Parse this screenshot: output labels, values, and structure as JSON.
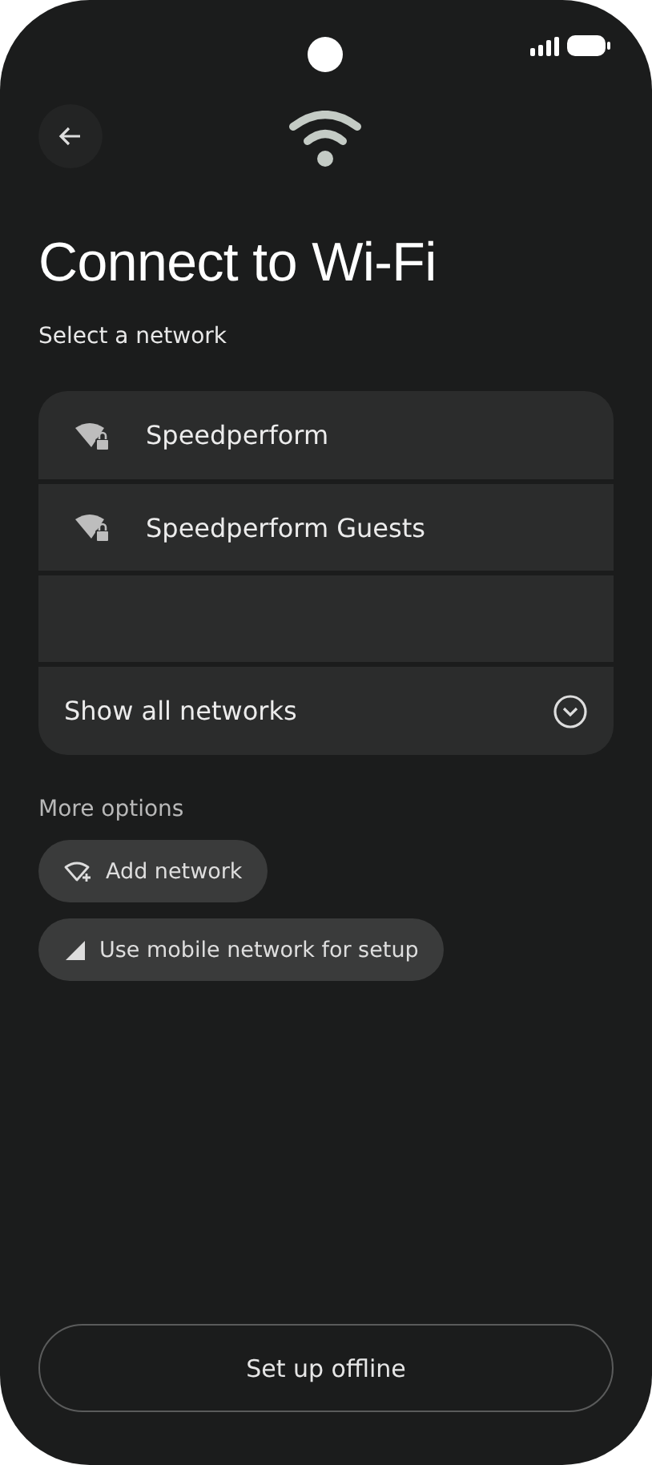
{
  "header": {
    "title": "Connect to Wi-Fi",
    "subtitle": "Select a network"
  },
  "networks": [
    {
      "kind": "network",
      "name": "Speedperform",
      "secured": true
    },
    {
      "kind": "network",
      "name": "Speedperform Guests",
      "secured": true
    },
    {
      "kind": "empty"
    },
    {
      "kind": "expander",
      "name": "Show all networks",
      "expanded": false
    }
  ],
  "more_options": {
    "label": "More options",
    "buttons": [
      {
        "kind": "add",
        "label": "Add network"
      },
      {
        "kind": "mobile",
        "label": "Use mobile network for setup"
      }
    ]
  },
  "footer_button": "Set up offline"
}
